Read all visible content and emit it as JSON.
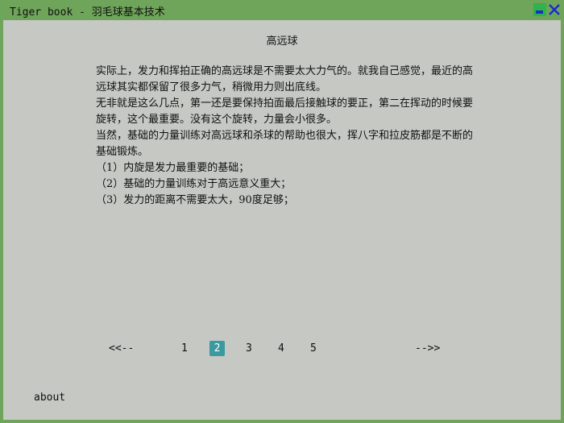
{
  "window": {
    "title": "Tiger book - 羽毛球基本技术"
  },
  "article": {
    "title": "高远球",
    "paragraphs": [
      "实际上，发力和挥拍正确的高远球是不需要太大力气的。就我自己感觉，最近的高远球其实都保留了很多力气，稍微用力则出底线。",
      "无非就是这么几点，第一还是要保持拍面最后接触球的要正，第二在挥动的时候要旋转，这个最重要。没有这个旋转，力量会小很多。",
      "当然，基础的力量训练对高远球和杀球的帮助也很大，挥八字和拉皮筋都是不断的基础锻炼。",
      "（1）内旋是发力最重要的基础；",
      "（2）基础的力量训练对于高远意义重大；",
      "（3）发力的距离不需要太大，90度足够；"
    ]
  },
  "pager": {
    "prev": "<<--",
    "next": "-->>",
    "pages": [
      "1",
      "2",
      "3",
      "4",
      "5"
    ],
    "current": "2"
  },
  "footer": {
    "about": "about"
  }
}
